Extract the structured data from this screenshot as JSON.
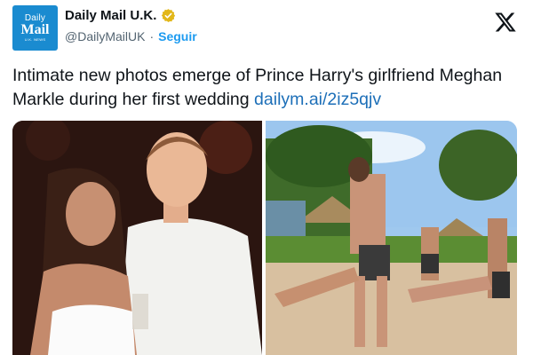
{
  "account": {
    "avatar_line1": "Daily",
    "avatar_line2": "Mail",
    "avatar_line3": "U.K. NEWS",
    "display_name": "Daily Mail U.K.",
    "handle": "@DailyMailUK",
    "separator": "·",
    "follow_label": "Seguir",
    "verified_badge_color": "#e2b719",
    "avatar_color": "#1a8bd0"
  },
  "platform": {
    "logo_icon": "x-logo-icon"
  },
  "tweet": {
    "text": "Intimate new photos emerge of Prince Harry's girlfriend Meghan Markle during her first wedding ",
    "link": "dailym.ai/2iz5qjv",
    "link_color": "#1d6fb8"
  },
  "media": {
    "photo_left": "couple-portrait-photo",
    "photo_right": "beach-wheelbarrow-race-photo"
  }
}
